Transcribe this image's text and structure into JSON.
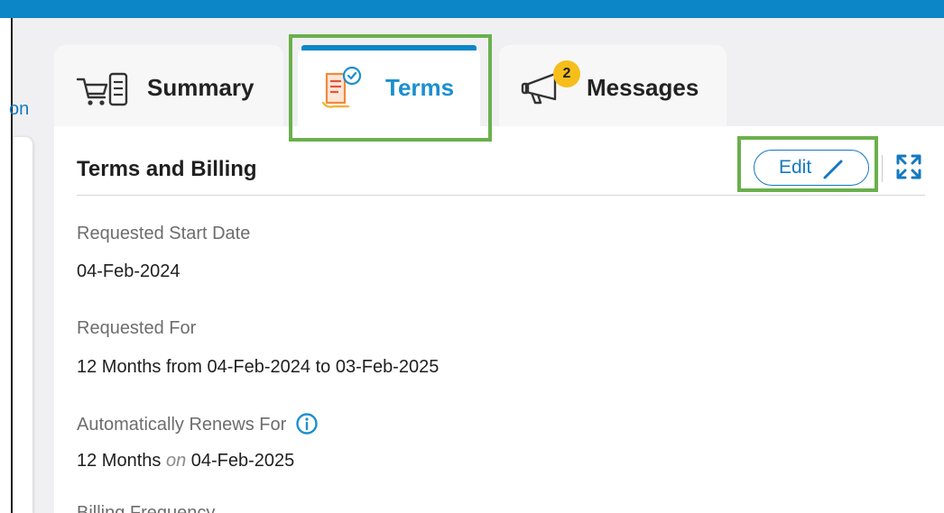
{
  "left_nav": {
    "fragment_text": "on"
  },
  "tabs": [
    {
      "label": "Summary",
      "icon": "cart-list-icon"
    },
    {
      "label": "Terms",
      "icon": "contract-check-icon",
      "active": true
    },
    {
      "label": "Messages",
      "icon": "megaphone-icon",
      "badge": "2"
    }
  ],
  "panel": {
    "title": "Terms and Billing",
    "edit_label": "Edit",
    "fields": [
      {
        "label": "Requested Start Date",
        "value": "04-Feb-2024"
      },
      {
        "label": "Requested For",
        "value": "12 Months from 04-Feb-2024 to 03-Feb-2025"
      },
      {
        "label": "Automatically Renews For",
        "value_prefix": "12 Months",
        "value_connector": "on",
        "value_suffix": "04-Feb-2025"
      },
      {
        "label": "Billing Frequency"
      }
    ]
  },
  "colors": {
    "accent": "#1479c0",
    "active_tab_text": "#1a8fcf",
    "top_bar": "#0c86c7",
    "badge": "#f6be1b",
    "highlight_box": "#6ab04c"
  }
}
